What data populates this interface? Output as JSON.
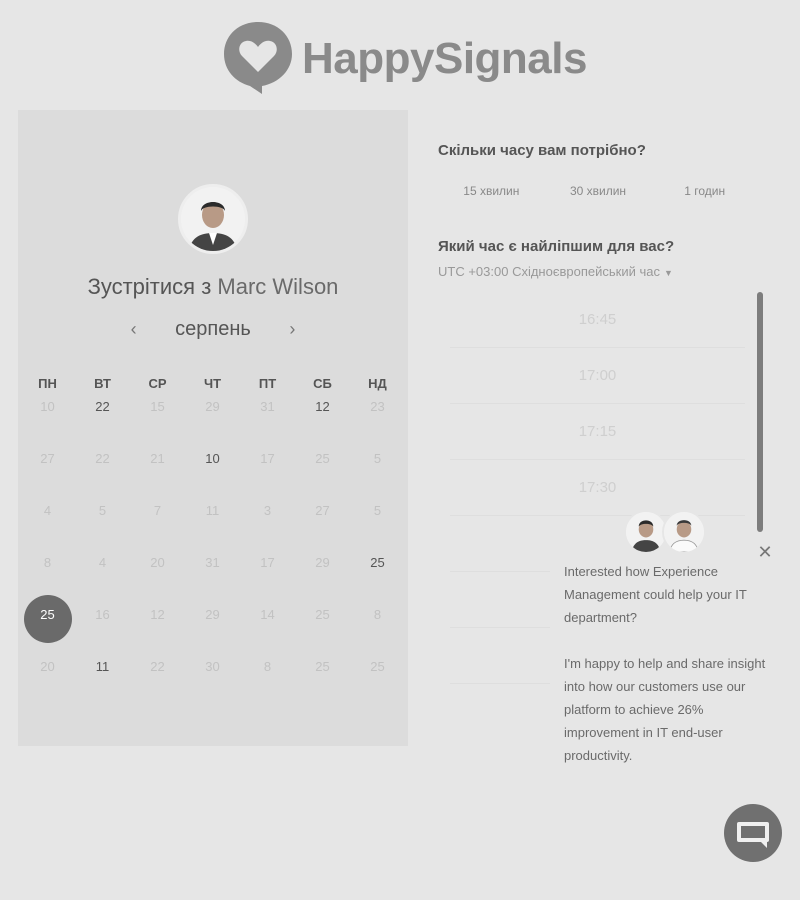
{
  "logo": {
    "wordmark": "HappySignals",
    "icon": "heart-speech-bubble-icon",
    "color": "#8a8a8a"
  },
  "calendar": {
    "avatar": "host-avatar",
    "title_prefix": "Зустрітися з",
    "host_name": "Marc Wilson",
    "month": "серпень",
    "prev_icon": "chevron-left-icon",
    "next_icon": "chevron-right-icon",
    "weekdays": [
      "ПН",
      "ВТ",
      "СР",
      "ЧТ",
      "ПТ",
      "СБ",
      "НД"
    ],
    "weeks": [
      [
        {
          "d": "10",
          "a": false
        },
        {
          "d": "22",
          "a": true
        },
        {
          "d": "15",
          "a": false
        },
        {
          "d": "29",
          "a": false
        },
        {
          "d": "31",
          "a": false
        },
        {
          "d": "12",
          "a": true
        },
        {
          "d": "23",
          "a": false
        }
      ],
      [
        {
          "d": "27",
          "a": false
        },
        {
          "d": "22",
          "a": false
        },
        {
          "d": "21",
          "a": false
        },
        {
          "d": "10",
          "a": true
        },
        {
          "d": "17",
          "a": false
        },
        {
          "d": "25",
          "a": false
        },
        {
          "d": "5",
          "a": false
        }
      ],
      [
        {
          "d": "4",
          "a": false
        },
        {
          "d": "5",
          "a": false
        },
        {
          "d": "7",
          "a": false
        },
        {
          "d": "11",
          "a": false
        },
        {
          "d": "3",
          "a": false
        },
        {
          "d": "27",
          "a": false
        },
        {
          "d": "5",
          "a": false
        }
      ],
      [
        {
          "d": "8",
          "a": false
        },
        {
          "d": "4",
          "a": false
        },
        {
          "d": "20",
          "a": false
        },
        {
          "d": "31",
          "a": false
        },
        {
          "d": "17",
          "a": false
        },
        {
          "d": "29",
          "a": false
        },
        {
          "d": "25",
          "a": true
        }
      ],
      [
        {
          "d": "25",
          "a": true,
          "s": true
        },
        {
          "d": "16",
          "a": false
        },
        {
          "d": "12",
          "a": false
        },
        {
          "d": "29",
          "a": false
        },
        {
          "d": "14",
          "a": false
        },
        {
          "d": "25",
          "a": false
        },
        {
          "d": "8",
          "a": false
        }
      ],
      [
        {
          "d": "20",
          "a": false
        },
        {
          "d": "11",
          "a": true
        },
        {
          "d": "22",
          "a": false
        },
        {
          "d": "30",
          "a": false
        },
        {
          "d": "8",
          "a": false
        },
        {
          "d": "25",
          "a": false
        },
        {
          "d": "25",
          "a": false
        }
      ]
    ]
  },
  "duration": {
    "title": "Скільки часу вам потрібно?",
    "options": [
      "15 хвилин",
      "30 хвилин",
      "1 годин"
    ]
  },
  "time": {
    "title": "Який час є найліпшим для вас?",
    "timezone": "UTC +03:00 Східноєвропейський час",
    "slots": [
      "16:45",
      "17:00",
      "17:15",
      "17:30",
      "",
      "",
      ""
    ]
  },
  "chat_popup": {
    "paragraph1": "Interested how Experience Management could help your IT department?",
    "paragraph2": "I'm happy to help and share insight into how our customers use our platform to achieve 26% improvement in IT end-user productivity.",
    "close_icon": "close-icon",
    "launcher_icon": "chat-bubble-icon"
  }
}
